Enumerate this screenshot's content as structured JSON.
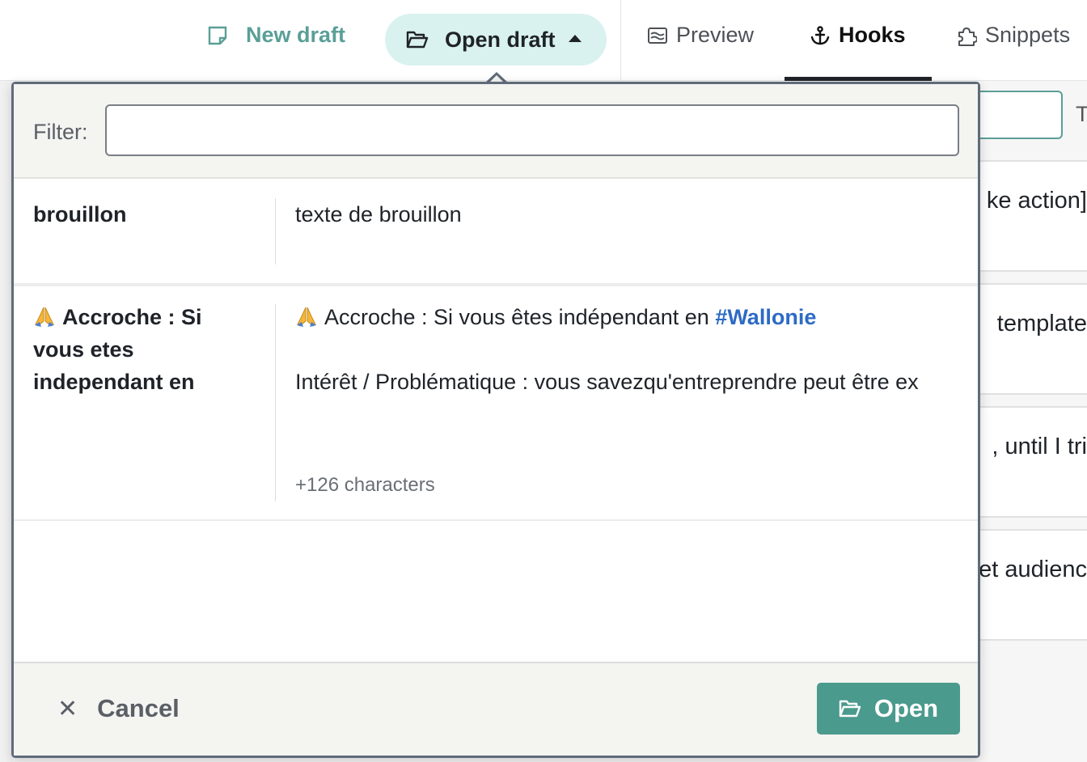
{
  "toolbar": {
    "new_draft_label": "New draft",
    "open_draft_label": "Open draft"
  },
  "tabs": [
    {
      "label": "Preview",
      "icon": "preview-icon",
      "active": false
    },
    {
      "label": "Hooks",
      "icon": "anchor-icon",
      "active": true
    },
    {
      "label": "Snippets",
      "icon": "puzzle-icon",
      "active": false
    }
  ],
  "background_panel": {
    "partial_letter": "T",
    "cards": [
      "ke action]",
      "template",
      ", until I tri",
      "et audienc"
    ]
  },
  "dialog": {
    "filter_label": "Filter:",
    "filter_value": "",
    "drafts": [
      {
        "title": "brouillon",
        "body_line1": "texte de brouillon"
      },
      {
        "title": "Accroche : Si vous etes independant en",
        "body_line1_text": "Accroche : Si vous êtes indépendant en ",
        "body_line1_hashtag": "#Wallonie",
        "body_line2": "Intérêt / Problématique : vous savezqu'entreprendre peut être ex",
        "more": "+126 characters"
      }
    ],
    "cancel_label": "Cancel",
    "open_label": "Open"
  },
  "colors": {
    "accent": "#4a9a8d",
    "accent_light": "#d9f2ef",
    "hashtag": "#2d6bc4",
    "modal_border": "#5f6b7a"
  }
}
